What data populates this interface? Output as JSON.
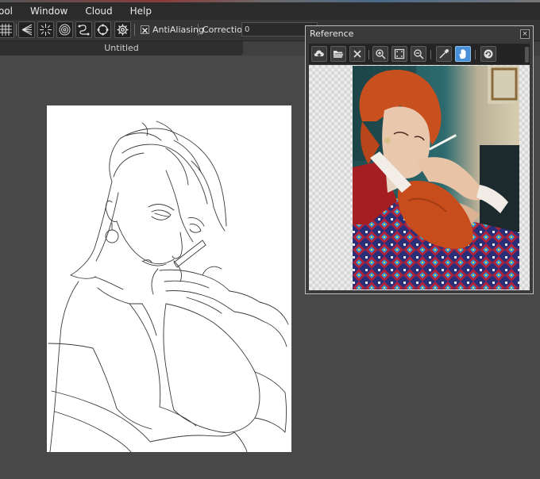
{
  "menu": {
    "items": [
      {
        "label": "ool"
      },
      {
        "label": "Window"
      },
      {
        "label": "Cloud"
      },
      {
        "label": "Help"
      }
    ]
  },
  "toolbar": {
    "tools": [
      {
        "icon": "grid-icon"
      },
      {
        "icon": "perspective-icon"
      },
      {
        "icon": "radial-lines-icon"
      },
      {
        "icon": "concentric-circle-icon"
      },
      {
        "icon": "curve-ruler-icon"
      },
      {
        "icon": "ellipse-ruler-icon"
      },
      {
        "icon": "gear-icon"
      }
    ],
    "antialiasing_label": "AntiAliasing",
    "antialiasing_checked": true,
    "correction_label": "Correction",
    "correction_value": "0"
  },
  "document": {
    "tab_label": "Untitled"
  },
  "reference_panel": {
    "title": "Reference",
    "close_glyph": "×",
    "tools": [
      {
        "icon": "cloud-upload-icon"
      },
      {
        "icon": "folder-open-icon"
      },
      {
        "icon": "clear-icon"
      },
      {
        "icon": "zoom-in-icon"
      },
      {
        "icon": "fit-screen-icon"
      },
      {
        "icon": "zoom-out-icon"
      },
      {
        "icon": "eyedropper-icon"
      },
      {
        "icon": "hand-icon"
      },
      {
        "icon": "rotate-icon"
      }
    ],
    "active_tool": "hand-icon"
  },
  "colors": {
    "app_background": "#484848",
    "menubar": "#2b2b2b",
    "toolbar": "#353535",
    "accent_active": "#4a90d9",
    "hair": "#c8501e"
  }
}
